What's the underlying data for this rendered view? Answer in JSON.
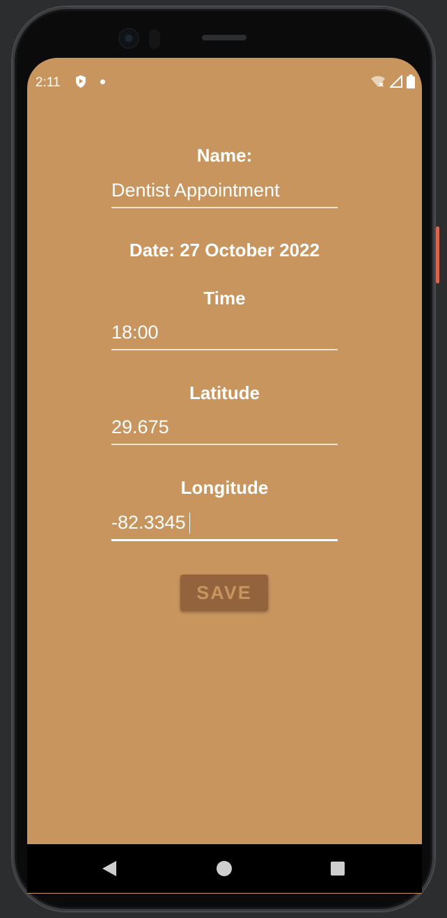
{
  "status_bar": {
    "time": "2:11",
    "icons": [
      "shield-icon",
      "notification-dot-icon",
      "wifi-icon",
      "signal-icon",
      "battery-icon"
    ]
  },
  "form": {
    "name_label": "Name:",
    "name_value": "Dentist Appointment",
    "date_label": "Date: 27 October 2022",
    "time_label": "Time",
    "time_value": "18:00",
    "latitude_label": "Latitude",
    "latitude_value": "29.675",
    "longitude_label": "Longitude",
    "longitude_value": "-82.3345",
    "save_label": "SAVE"
  },
  "nav_bar": {
    "icons": [
      "back-icon",
      "home-icon",
      "recents-icon"
    ]
  },
  "colors": {
    "background": "#c8955e",
    "button": "#93633e",
    "text": "#ffffff"
  }
}
